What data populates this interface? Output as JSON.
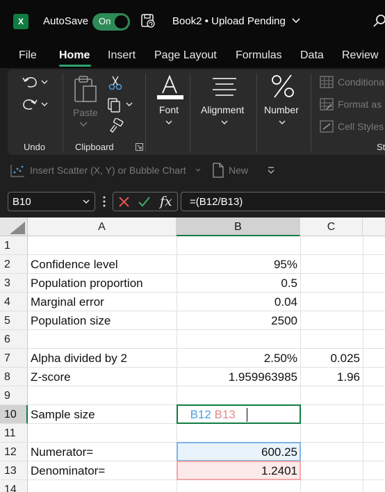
{
  "titlebar": {
    "app_logo": "X",
    "autosave_label": "AutoSave",
    "autosave_state": "On",
    "book_title": "Book2 • Upload Pending"
  },
  "menu": {
    "tabs": [
      "File",
      "Home",
      "Insert",
      "Page Layout",
      "Formulas",
      "Data",
      "Review"
    ],
    "active": "Home"
  },
  "ribbon": {
    "undo_label": "Undo",
    "clipboard_label": "Clipboard",
    "paste_label": "Paste",
    "font_label": "Font",
    "alignment_label": "Alignment",
    "number_label": "Number",
    "styles_items": [
      "Conditional",
      "Format as",
      "Cell Styles"
    ],
    "styles_label": "St"
  },
  "quick_access": {
    "insert_chart": "Insert Scatter (X, Y) or Bubble Chart",
    "new_label": "New"
  },
  "formula_bar": {
    "name_box": "B10",
    "fx_symbol": "fx",
    "formula": "=(B12/B13)"
  },
  "grid": {
    "columns": [
      "A",
      "B",
      "C"
    ],
    "selected_column": "B",
    "row_numbers": [
      "1",
      "2",
      "3",
      "4",
      "5",
      "6",
      "7",
      "8",
      "9",
      "10",
      "11",
      "12",
      "13",
      "14"
    ],
    "selected_row": "10",
    "cells": {
      "A2": "Confidence level",
      "B2": "95%",
      "A3": "Population proportion",
      "B3": "0.5",
      "A4": "Marginal error",
      "B4": "0.04",
      "A5": "Population size",
      "B5": "2500",
      "A7": "Alpha divided by 2",
      "B7": "2.50%",
      "C7": "0.025",
      "A8": "Z-score",
      "B8": "1.959963985",
      "C8": "1.96",
      "A10": "Sample size",
      "A12": "Numerator=",
      "B12": "600.25",
      "A13": "Denominator=",
      "B13": "1.2401"
    },
    "edit_formula": {
      "prefix": "=(",
      "ref1": "B12",
      "sep": "/",
      "ref2": "B13",
      "suffix": ")"
    }
  },
  "colors": {
    "accent": "#107c41",
    "ref_blue": "#4f9ee0",
    "ref_red": "#e88a8a"
  }
}
